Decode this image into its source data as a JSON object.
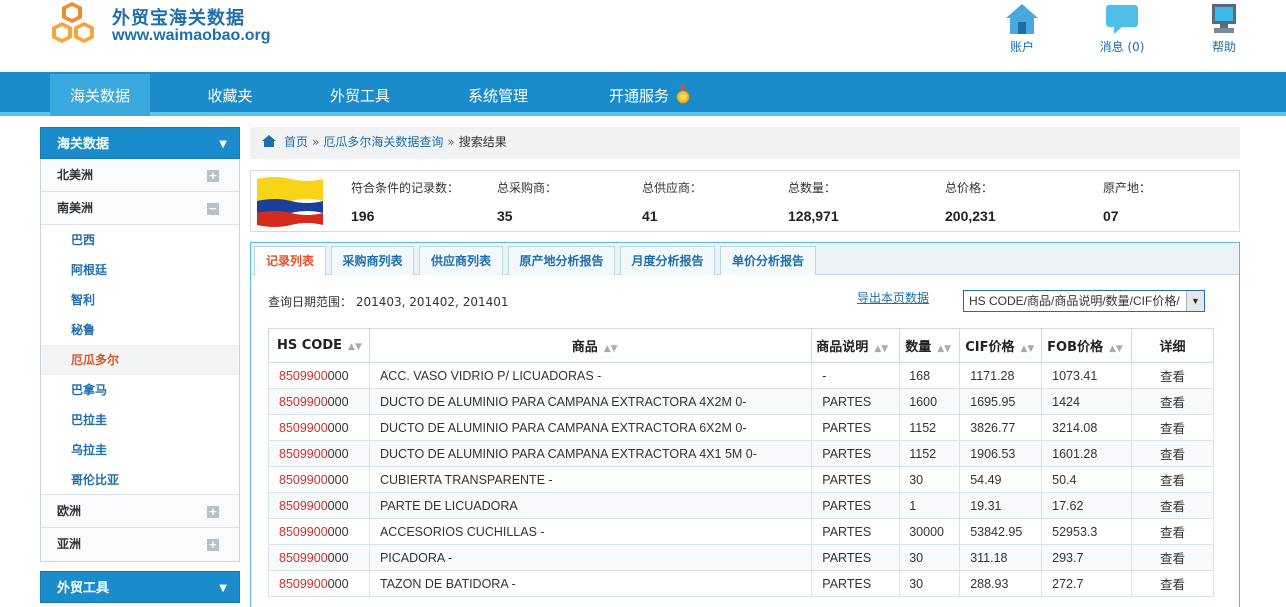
{
  "brand": {
    "title": "外贸宝海关数据",
    "url": "www.waimaobao.org"
  },
  "header_links": [
    {
      "label": "账户",
      "icon": "home-icon"
    },
    {
      "label": "消息 (0)",
      "icon": "message-icon"
    },
    {
      "label": "帮助",
      "icon": "computer-icon"
    }
  ],
  "nav": {
    "items": [
      "海关数据",
      "收藏夹",
      "外贸工具",
      "系统管理",
      "开通服务"
    ],
    "active": "海关数据"
  },
  "sidebar": {
    "title": "海关数据",
    "regions": {
      "north_america": "北美洲",
      "south_america": "南美洲",
      "europe": "欧洲",
      "asia": "亚洲"
    },
    "countries": [
      "巴西",
      "阿根廷",
      "智利",
      "秘鲁",
      "厄瓜多尔",
      "巴拿马",
      "巴拉圭",
      "乌拉圭",
      "哥伦比亚"
    ],
    "active_country": "厄瓜多尔",
    "section2_title": "外贸工具"
  },
  "breadcrumb": {
    "home": "首页",
    "query": "厄瓜多尔海关数据查询",
    "current": "搜索结果",
    "sep": "»"
  },
  "summary": {
    "records_label": "符合条件的记录数：",
    "records": "196",
    "buyers_label": "总采购商：",
    "buyers": "35",
    "suppliers_label": "总供应商：",
    "suppliers": "41",
    "quantity_label": "总数量：",
    "quantity": "128,971",
    "price_label": "总价格：",
    "price": "200,231",
    "origin_label": "原产地：",
    "origin": "07"
  },
  "tabs": [
    "记录列表",
    "采购商列表",
    "供应商列表",
    "原产地分析报告",
    "月度分析报告",
    "单价分析报告"
  ],
  "active_tab": "记录列表",
  "query_range": "查询日期范围： 201403, 201402, 201401",
  "export_label": "导出本页数据",
  "select_value": "HS CODE/商品/商品说明/数量/CIF价格/",
  "table": {
    "headers": [
      "HS CODE",
      "商品",
      "商品说明",
      "数量",
      "CIF价格",
      "FOB价格",
      "详细"
    ],
    "rows": [
      {
        "hs_red": "8509900",
        "hs_rest": "000",
        "product": "ACC. VASO VIDRIO P/ LICUADORAS -",
        "desc": "-",
        "qty": "168",
        "cif": "1171.28",
        "fob": "1073.41",
        "detail": "查看"
      },
      {
        "hs_red": "8509900",
        "hs_rest": "000",
        "product": "DUCTO DE ALUMINIO PARA CAMPANA EXTRACTORA 4X2M 0-",
        "desc": "PARTES",
        "qty": "1600",
        "cif": "1695.95",
        "fob": "1424",
        "detail": "查看"
      },
      {
        "hs_red": "8509900",
        "hs_rest": "000",
        "product": "DUCTO DE ALUMINIO PARA CAMPANA EXTRACTORA 6X2M 0-",
        "desc": "PARTES",
        "qty": "1152",
        "cif": "3826.77",
        "fob": "3214.08",
        "detail": "查看"
      },
      {
        "hs_red": "8509900",
        "hs_rest": "000",
        "product": "DUCTO DE ALUMINIO PARA CAMPANA EXTRACTORA 4X1 5M 0-",
        "desc": "PARTES",
        "qty": "1152",
        "cif": "1906.53",
        "fob": "1601.28",
        "detail": "查看"
      },
      {
        "hs_red": "8509900",
        "hs_rest": "000",
        "product": "CUBIERTA TRANSPARENTE -",
        "desc": "PARTES",
        "qty": "30",
        "cif": "54.49",
        "fob": "50.4",
        "detail": "查看"
      },
      {
        "hs_red": "8509900",
        "hs_rest": "000",
        "product": "PARTE DE LICUADORA",
        "desc": "PARTES",
        "qty": "1",
        "cif": "19.31",
        "fob": "17.62",
        "detail": "查看"
      },
      {
        "hs_red": "8509900",
        "hs_rest": "000",
        "product": "ACCESORIOS CUCHILLAS -",
        "desc": "PARTES",
        "qty": "30000",
        "cif": "53842.95",
        "fob": "52953.3",
        "detail": "查看"
      },
      {
        "hs_red": "8509900",
        "hs_rest": "000",
        "product": "PICADORA -",
        "desc": "PARTES",
        "qty": "30",
        "cif": "311.18",
        "fob": "293.7",
        "detail": "查看"
      },
      {
        "hs_red": "8509900",
        "hs_rest": "000",
        "product": "TAZON DE BATIDORA -",
        "desc": "PARTES",
        "qty": "30",
        "cif": "288.93",
        "fob": "272.7",
        "detail": "查看"
      }
    ]
  },
  "colors": {
    "nav_bg": "#1a8ccb",
    "nav_active": "#3aa9dd",
    "link": "#1f6fae",
    "active_red": "#e0522a",
    "hs_red": "#d0302b"
  }
}
